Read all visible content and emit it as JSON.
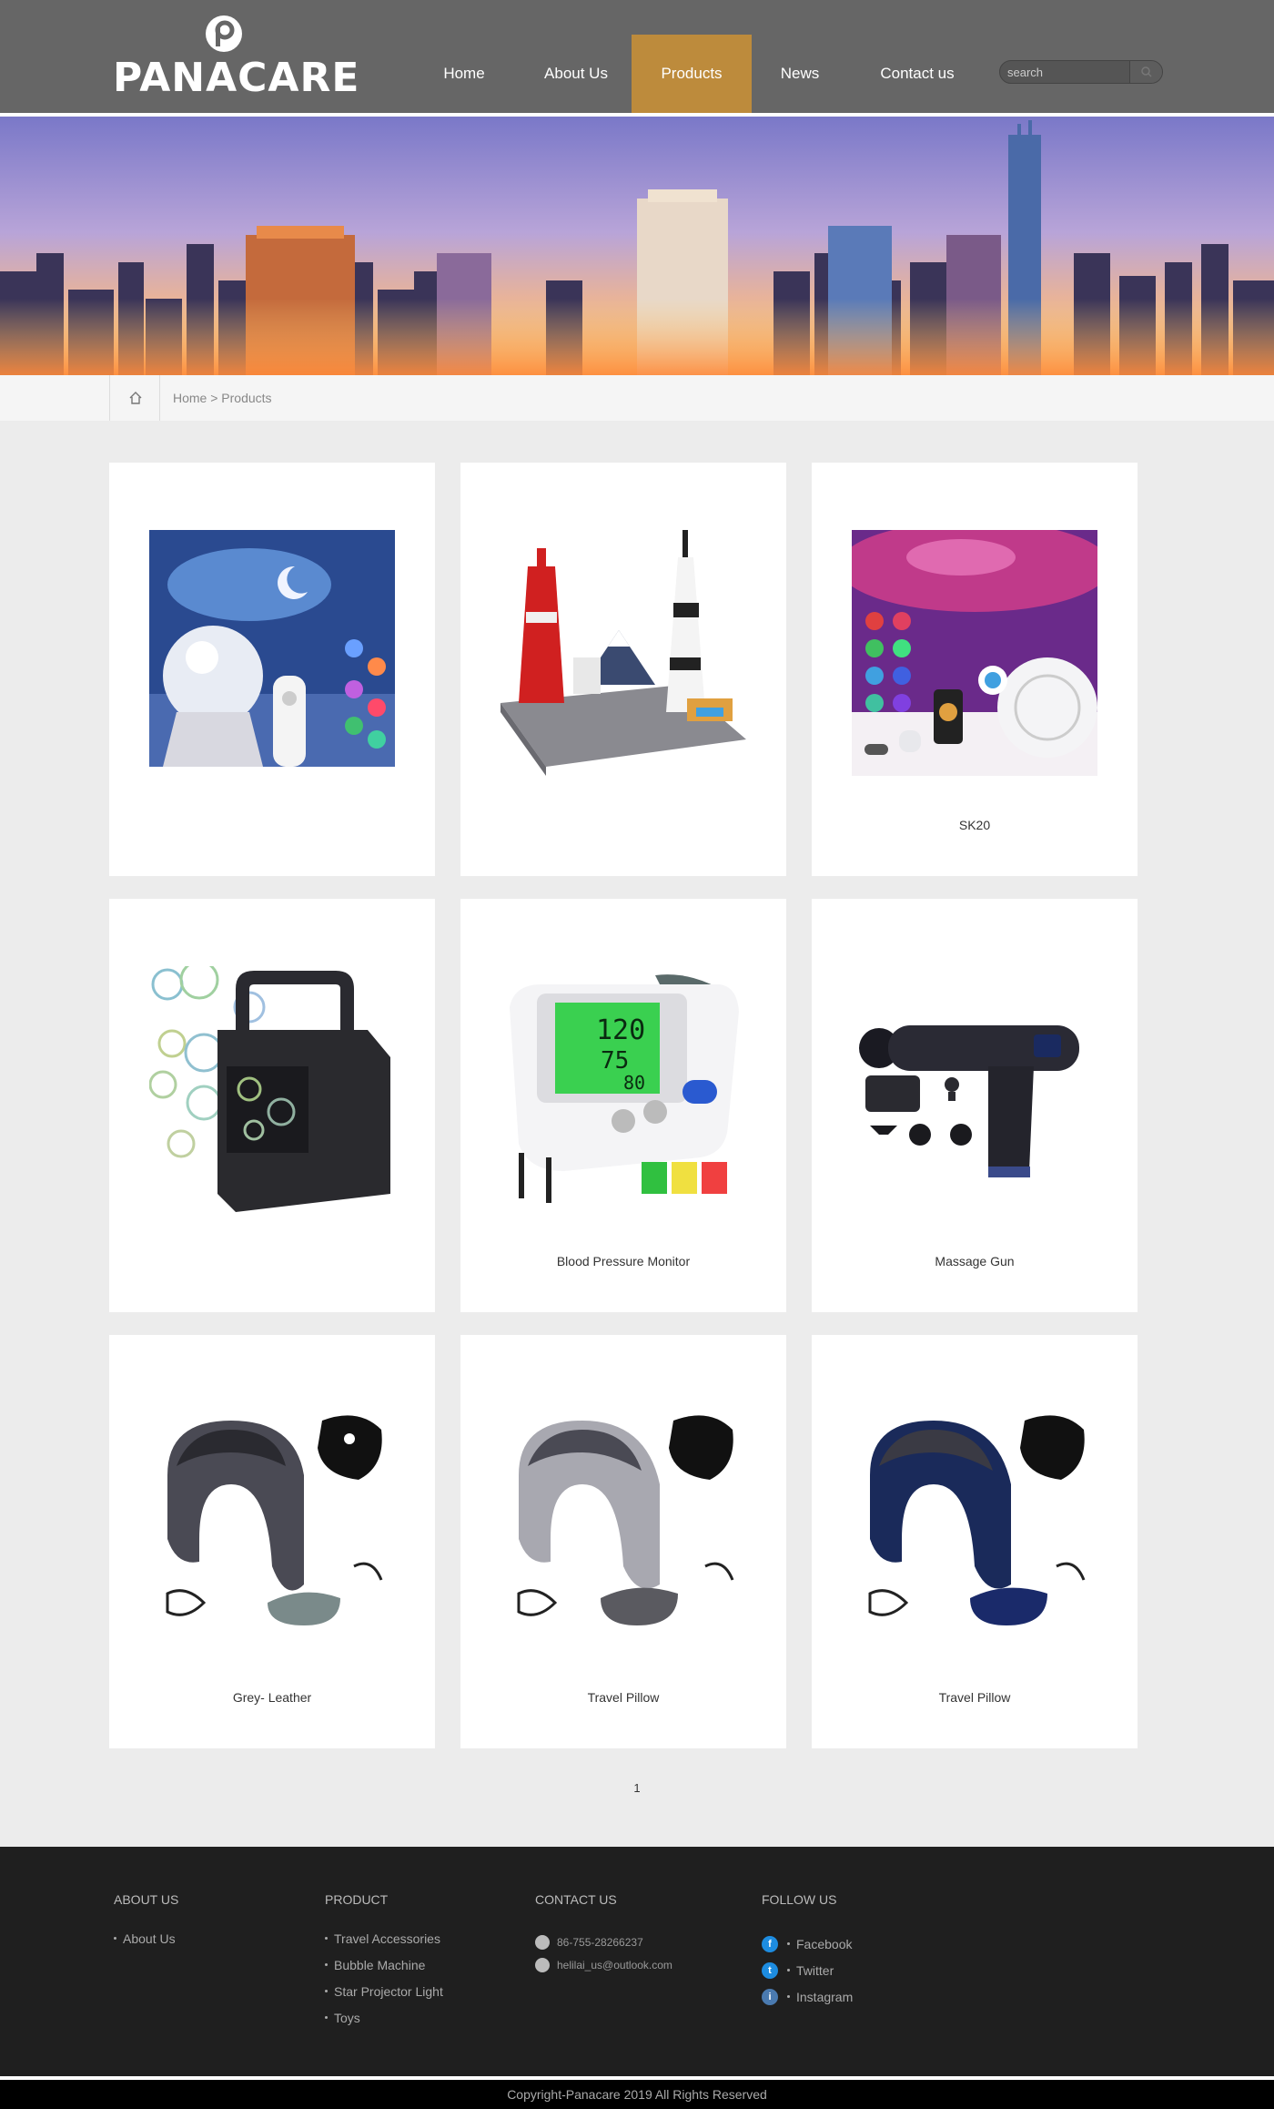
{
  "brand": {
    "name": "PANACARE"
  },
  "nav": {
    "items": [
      {
        "label": "Home"
      },
      {
        "label": "About Us"
      },
      {
        "label": "Products"
      },
      {
        "label": "News"
      },
      {
        "label": "Contact us"
      }
    ],
    "active_index": 2,
    "active_color": "#bd8b3c"
  },
  "search": {
    "placeholder": "search"
  },
  "breadcrumb": {
    "text": "Home > Products"
  },
  "products": [
    {
      "title": "",
      "image": "star-projector-galaxy"
    },
    {
      "title": "",
      "image": "building-block-skyline"
    },
    {
      "title": "SK20",
      "image": "star-projector-sk20"
    },
    {
      "title": "",
      "image": "bubble-machine"
    },
    {
      "title": "Blood Pressure Monitor",
      "image": "blood-pressure-monitor"
    },
    {
      "title": "Massage Gun",
      "image": "massage-gun"
    },
    {
      "title": "Grey- Leather",
      "image": "travel-pillow-grey-leather"
    },
    {
      "title": "Travel Pillow",
      "image": "travel-pillow-grey"
    },
    {
      "title": "Travel Pillow",
      "image": "travel-pillow-navy"
    }
  ],
  "pagination": {
    "current": "1"
  },
  "footer": {
    "about": {
      "heading": "ABOUT US",
      "links": [
        "About Us"
      ]
    },
    "product": {
      "heading": "PRODUCT",
      "links": [
        "Travel Accessories",
        "Bubble Machine",
        "Star Projector Light",
        "Toys"
      ]
    },
    "contact": {
      "heading": "CONTACT US",
      "phone": "86-755-28266237",
      "email": "helilai_us@outlook.com"
    },
    "follow": {
      "heading": "FOLLOW US",
      "links": [
        "Facebook",
        "Twitter",
        "Instagram"
      ]
    },
    "copyright": "Copyright-Panacare 2019 All Rights Reserved"
  }
}
